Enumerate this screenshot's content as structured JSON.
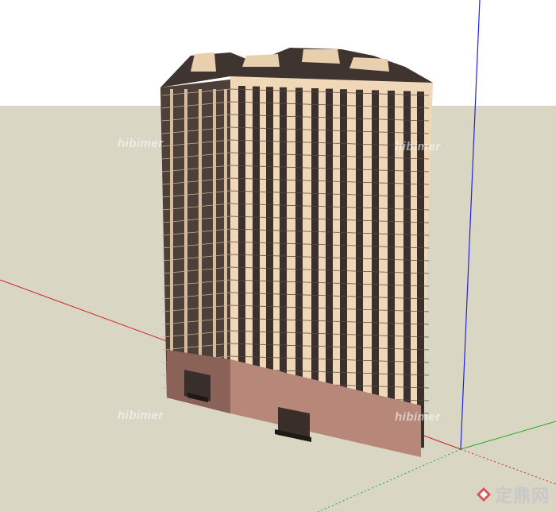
{
  "scene": {
    "sky_color": "#ffffff",
    "ground_color": "#d9d6c4",
    "building_facade_color": "#f2dcbf",
    "building_shadow_color": "#5a4a44",
    "base_color": "#b08070",
    "axis_red": "#cc2222",
    "axis_green": "#22aa22",
    "axis_blue": "#2222dd"
  },
  "watermarks": {
    "text_1": "hibimer",
    "text_2": "hibimer",
    "text_3": "hibimer",
    "text_4": "hibimer"
  },
  "brand": {
    "name": "定鼎网",
    "logo_icon": "diamond-logo-icon"
  }
}
